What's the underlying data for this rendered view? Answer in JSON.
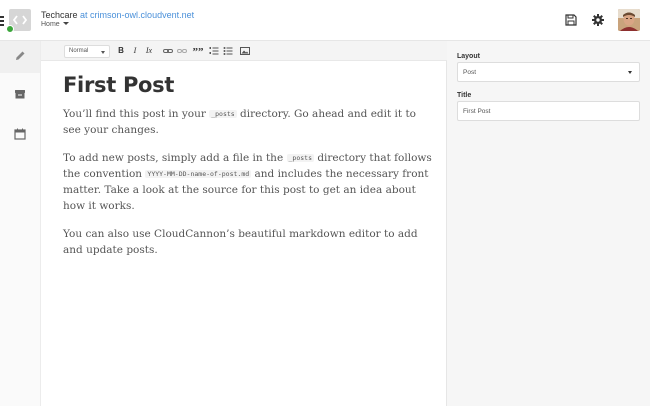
{
  "header": {
    "site_name": "Techcare",
    "site_host": "at crimson-owl.cloudvent.net",
    "branch": "Home"
  },
  "icons": {
    "menu": "hamburger-icon",
    "site": "code-brackets-icon",
    "status": "online-status-dot",
    "save": "floppy-disk-icon",
    "settings": "gear-icon",
    "nav_edit": "pencil-icon",
    "nav_collections": "inbox-tray-icon",
    "nav_calendar": "calendar-icon"
  },
  "toolbar": {
    "format": "Normal",
    "bold": "B",
    "italic": "I",
    "clear": "Ix",
    "quote": "””"
  },
  "post": {
    "title": "First Post",
    "p1_before": "You’ll find this post in your ",
    "p1_code": "_posts",
    "p1_after": " directory. Go ahead and edit it to see your changes.",
    "p2_before": "To add new posts, simply add a file in the ",
    "p2_code1": "_posts",
    "p2_mid": " directory that follows the convention ",
    "p2_code2": "YYYY-MM-DD-name-of-post.md",
    "p2_after": " and includes the necessary front matter. Take a look at the source for this post to get an idea about how it works.",
    "p3": "You can also use CloudCannon’s beautiful markdown editor to add and update posts."
  },
  "panel": {
    "layout_label": "Layout",
    "layout_value": "Post",
    "title_label": "Title",
    "title_value": "First Post"
  },
  "colors": {
    "accent_link": "#4a90d9",
    "status_green": "#3aa63a",
    "panel_bg": "#f6f6f6"
  }
}
